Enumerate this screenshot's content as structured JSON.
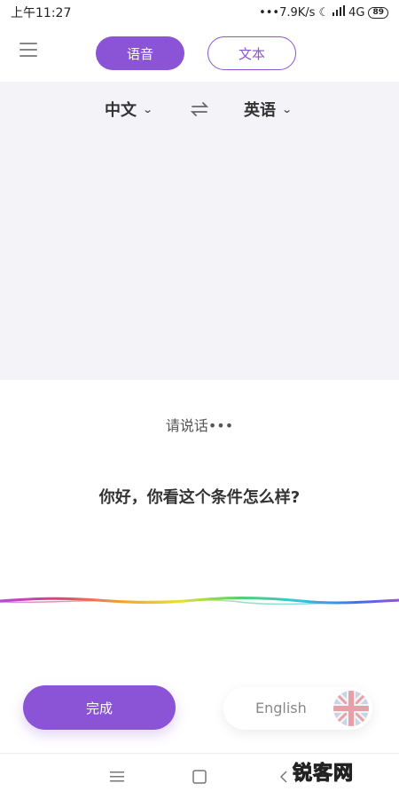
{
  "status_bar": {
    "time": "上午11:27",
    "network_speed": "•••7.9K/s",
    "signal": "4G",
    "battery": "89"
  },
  "header": {
    "tabs": [
      {
        "label": "语音",
        "active": true
      },
      {
        "label": "文本",
        "active": false
      }
    ]
  },
  "translator": {
    "source_lang": "中文",
    "target_lang": "英语"
  },
  "speech": {
    "prompt": "请说话•••",
    "recognized_text": "你好，你看这个条件怎么样?"
  },
  "footer": {
    "done_label": "完成",
    "language_label": "English"
  },
  "watermark": "锐客网",
  "colors": {
    "accent": "#8b53d6",
    "panel_bg": "#f4f4f8"
  }
}
